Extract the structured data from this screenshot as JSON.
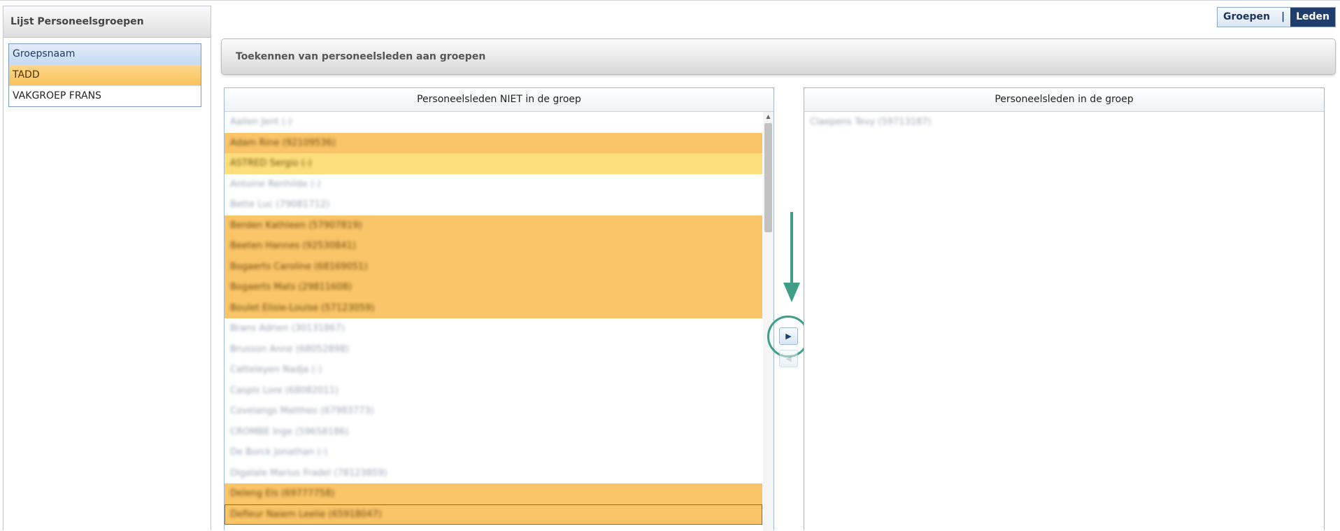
{
  "sidebar": {
    "title": "Lijst Personeelsgroepen",
    "header": "Groepsnaam",
    "groups": [
      "TADD",
      "VAKGROEP FRANS"
    ]
  },
  "toggle": {
    "groepen": "Groepen",
    "separator": "|",
    "leden": "Leden"
  },
  "main": {
    "title": "Toekennen van personeelsleden aan groepen"
  },
  "left_panel": {
    "title": "Personeelsleden NIET in de groep",
    "members": [
      "Aallen Jent (-)",
      "Adam Rine (92109536)",
      "ASTRED Sergio (-)",
      "Antoine Renhilde (-)",
      "Bette Luc (79081712)",
      "Berden Kathleen (57907819)",
      "Beeten Hannes (92530841)",
      "Bogaerts Caroline (68169051)",
      "Bogaerts Mats (29811608)",
      "Boulet Elisie-Louise (57123059)",
      "Brans Adrien (30131867)",
      "Brusson Anne (68052898)",
      "Catteleyen Nadja (-)",
      "Caspls Lore (68082011)",
      "Covelangs Mattheo (67983773)",
      "CROMBE Inge (59658186)",
      "De Borck Jonathan (-)",
      "Digalale Marius Fradel (78123859)",
      "Deleng Els (69777758)",
      "Defleur Naiem Leelie (65918047)"
    ]
  },
  "right_panel": {
    "title": "Personeelsleden in de groep",
    "members": [
      "Claepens Tevy (59713187)"
    ]
  },
  "controls": {
    "move_right": "▶",
    "move_left": "◀",
    "scroll_up": "▲"
  },
  "colors": {
    "accent": "#1f3e6b",
    "highlight": "#fac568",
    "annotation": "#3e9e88"
  }
}
